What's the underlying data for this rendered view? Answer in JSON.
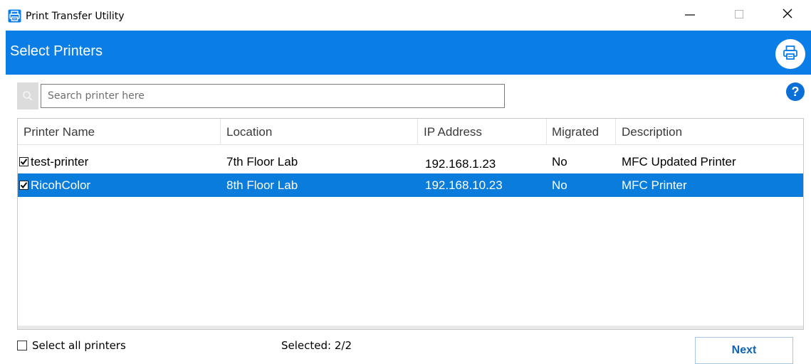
{
  "window": {
    "title": "Print Transfer Utility",
    "minimize_icon": "minimize-icon",
    "maximize_icon": "maximize-icon",
    "close_icon": "close-icon",
    "app_icon": "printer-icon"
  },
  "header": {
    "title": "Select Printers",
    "accent_color": "#0a7ee6",
    "print_icon": "printer-icon"
  },
  "search": {
    "placeholder": "Search printer here",
    "value": "",
    "icon": "search-icon"
  },
  "help": {
    "label": "?",
    "icon": "help-icon"
  },
  "table": {
    "columns": [
      "Printer Name",
      "Location",
      "IP Address",
      "Migrated",
      "Description"
    ],
    "rows": [
      {
        "checked": true,
        "name": "test-printer",
        "location": "7th Floor Lab",
        "ip": "192.168.1.23",
        "migrated": "No",
        "description": "MFC Updated Printer",
        "selected": false
      },
      {
        "checked": true,
        "name": "RicohColor",
        "location": "8th Floor Lab",
        "ip": "192.168.10.23",
        "migrated": "No",
        "description": "MFC Printer",
        "selected": true
      }
    ],
    "selected_row_color": "#0a7cdb"
  },
  "footer": {
    "select_all_label": "Select all printers",
    "select_all_checked": false,
    "selected_count": "Selected: 2/2",
    "next_label": "Next"
  }
}
